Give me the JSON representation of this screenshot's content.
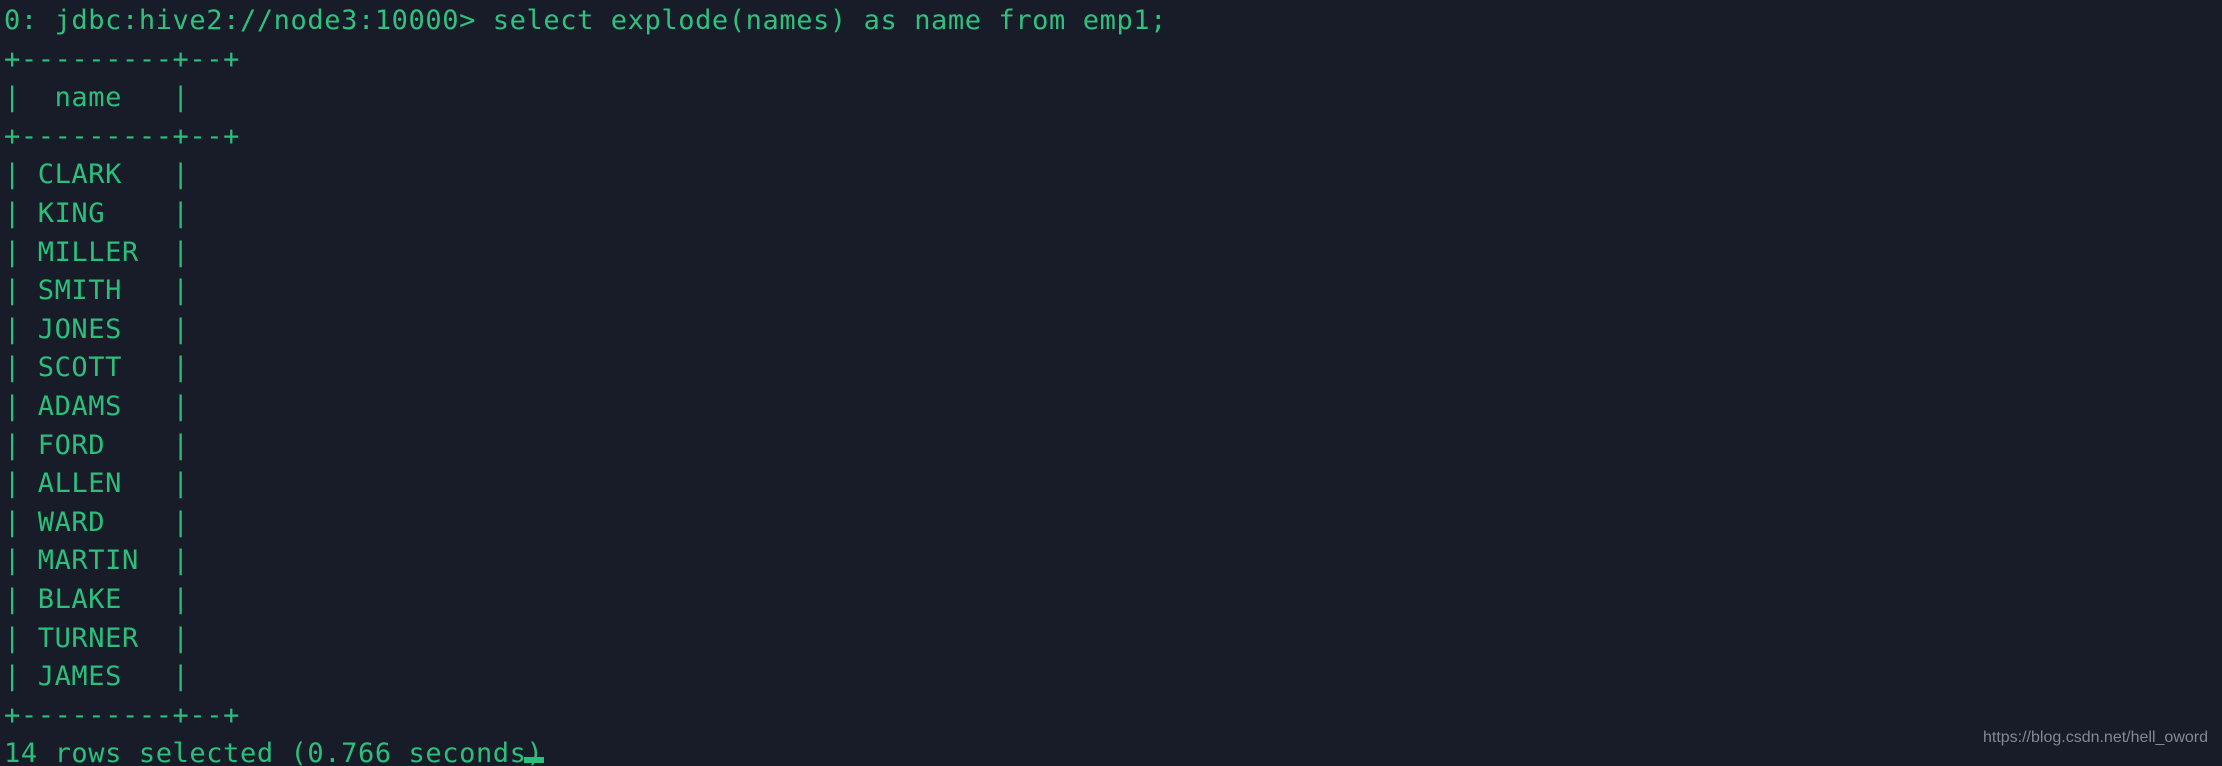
{
  "terminal": {
    "background_color": "#181c28",
    "text_color": "#2ac07b",
    "prompt_line": "0: jdbc:hive2://node3:10000> select explode(names) as name from emp1;",
    "prompt_prefix": "0: jdbc:hive2://node3:10000>",
    "command": "select explode(names) as name from emp1;",
    "rule_line": "+---------+--+",
    "header_line": "|  name   |",
    "status_line": "14 rows selected (0.766 seconds)",
    "row_count_label": "14 rows selected",
    "elapsed_label": "(0.766 seconds)",
    "rows": [
      "| CLARK   |",
      "| KING    |",
      "| MILLER  |",
      "| SMITH   |",
      "| JONES   |",
      "| SCOTT   |",
      "| ADAMS   |",
      "| FORD    |",
      "| ALLEN   |",
      "| WARD    |",
      "| MARTIN  |",
      "| BLAKE   |",
      "| TURNER  |",
      "| JAMES   |"
    ],
    "table": {
      "columns": [
        "name"
      ],
      "values": [
        "CLARK",
        "KING",
        "MILLER",
        "SMITH",
        "JONES",
        "SCOTT",
        "ADAMS",
        "FORD",
        "ALLEN",
        "WARD",
        "MARTIN",
        "BLAKE",
        "TURNER",
        "JAMES"
      ]
    },
    "cursor": "block-cursor"
  },
  "watermark": {
    "text": "https://blog.csdn.net/hell_oword",
    "color": "#8d929e"
  }
}
